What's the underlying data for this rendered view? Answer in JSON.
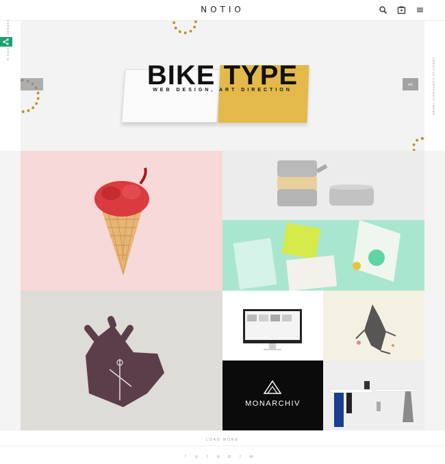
{
  "header": {
    "logo": "NOTIO",
    "icons": [
      "search-icon",
      "cart-icon",
      "menu-icon"
    ]
  },
  "side": {
    "left_text": "© 2015 FUEL THEMES",
    "right_text": "CREATIVE CORPORATE THEME"
  },
  "hero": {
    "title": "BIKE TYPE",
    "subtitle": "WEB DESIGN, ART DIRECTION",
    "next_arrow": "⇨"
  },
  "tiles": {
    "monarchiv": "MONARCHIV"
  },
  "load_more": "LOAD MORE",
  "social": {
    "icons": [
      "facebook-icon",
      "dribbble-icon",
      "twitter-icon",
      "linkedin-icon",
      "instagram-icon",
      "tumblr-icon",
      "vk-icon"
    ],
    "glyphs": [
      "f",
      "◎",
      "t",
      "in",
      "◘",
      "t",
      "vk"
    ]
  },
  "colors": {
    "accent": "#1aa36b",
    "gold": "#e3b94a"
  }
}
